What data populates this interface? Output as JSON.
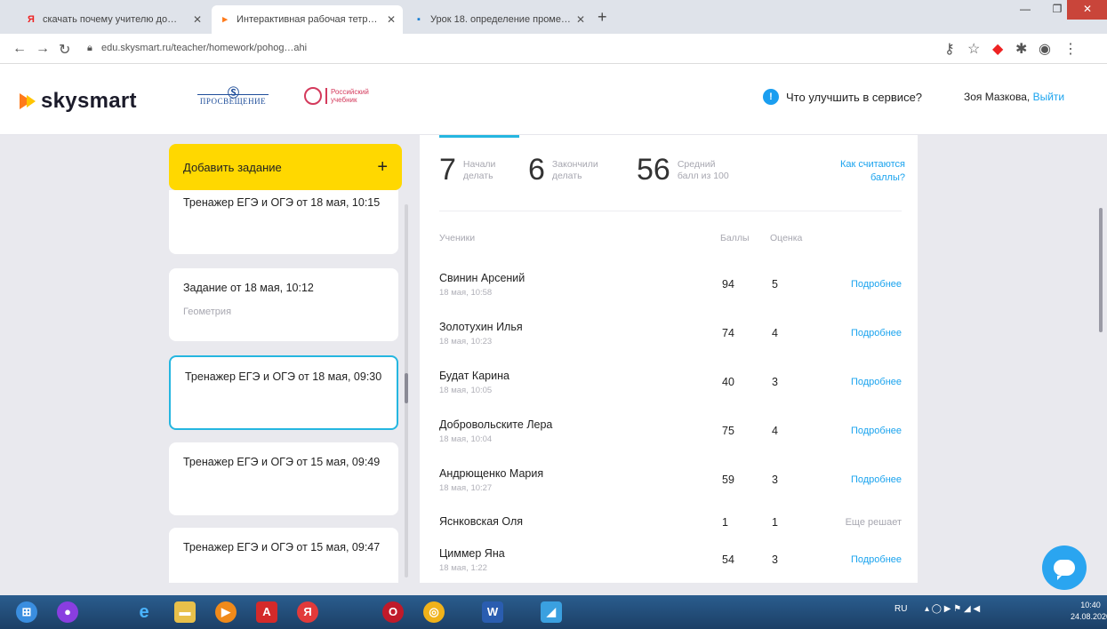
{
  "browser": {
    "tabs": [
      {
        "label": "скачать почему учителю до…"
      },
      {
        "label": "Интерактивная рабочая тетрад…"
      },
      {
        "label": "Урок 18. определение промеж…"
      }
    ],
    "url": "edu.skysmart.ru/teacher/homework/pohog…ahi"
  },
  "header": {
    "logo": "skysmart",
    "partner1_top": "Ⓢ",
    "partner1": "ПРОСВЕЩЕНИЕ",
    "partner2_line1": "Российский",
    "partner2_line2": "учебник",
    "improve_label": "Что улучшить в сервисе?",
    "user_name": "Зоя Мазкова,",
    "logout": "Выйти"
  },
  "sidebar": {
    "add_task": "Добавить задание",
    "add_plus": "+",
    "tasks": [
      {
        "title": "Тренажер ЕГЭ и ОГЭ от 18 мая, 10:15",
        "subtitle": ""
      },
      {
        "title": "Задание от 18 мая, 10:12",
        "subtitle": "Геометрия"
      },
      {
        "title": "Тренажер ЕГЭ и ОГЭ от 18 мая, 09:30",
        "subtitle": ""
      },
      {
        "title": "Тренажер ЕГЭ и ОГЭ от 15 мая, 09:49",
        "subtitle": ""
      },
      {
        "title": "Тренажер ЕГЭ и ОГЭ от 15 мая, 09:47",
        "subtitle": ""
      }
    ]
  },
  "stats": {
    "started_num": "7",
    "started_label_1": "Начали",
    "started_label_2": "делать",
    "finished_num": "6",
    "finished_label_1": "Закончили",
    "finished_label_2": "делать",
    "avg_num": "56",
    "avg_label_1": "Средний",
    "avg_label_2": "балл из 100",
    "how_link": "Как считаются баллы?"
  },
  "table": {
    "col_student": "Ученики",
    "col_score": "Баллы",
    "col_grade": "Оценка",
    "rows": [
      {
        "name": "Свинин Арсений",
        "date": "18 мая, 10:58",
        "score": "94",
        "grade": "5",
        "action": "Подробнее"
      },
      {
        "name": "Золотухин Илья",
        "date": "18 мая, 10:23",
        "score": "74",
        "grade": "4",
        "action": "Подробнее"
      },
      {
        "name": "Будат Карина",
        "date": "18 мая, 10:05",
        "score": "40",
        "grade": "3",
        "action": "Подробнее"
      },
      {
        "name": "Добровольските Лера",
        "date": "18 мая, 10:04",
        "score": "75",
        "grade": "4",
        "action": "Подробнее"
      },
      {
        "name": "Андрющенко Мария",
        "date": "18 мая, 10:27",
        "score": "59",
        "grade": "3",
        "action": "Подробнее"
      },
      {
        "name": "Яснковская Оля",
        "date": "",
        "score": "1",
        "grade": "1",
        "action": "Еще решает"
      },
      {
        "name": "Циммер Яна",
        "date": "18 мая, 1:22",
        "score": "54",
        "grade": "3",
        "action": "Подробнее"
      }
    ]
  },
  "taskbar": {
    "tray": "RU",
    "time": "10:40",
    "date": "24.08.2020"
  },
  "colors": {
    "accent": "#1aa3ee",
    "yellow": "#ffd800",
    "selected_border": "#25b6e0"
  }
}
